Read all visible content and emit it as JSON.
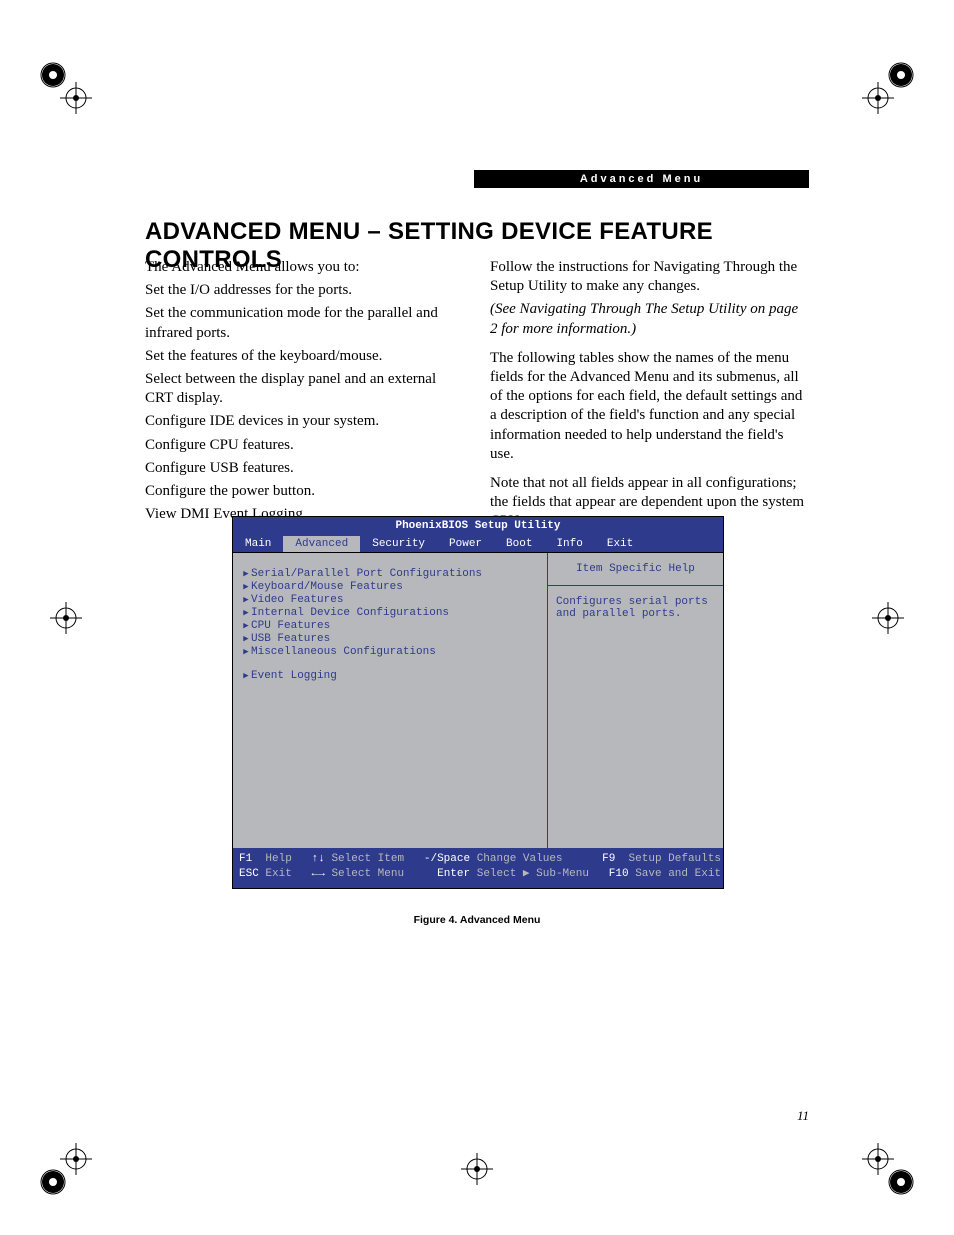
{
  "running_header": "Advanced Menu",
  "title": "ADVANCED MENU – SETTING DEVICE FEATURE CONTROLS",
  "intro": "The Advanced Menu allows you to:",
  "bullets": [
    "Set the I/O addresses for the ports.",
    "Set the communication mode for the parallel and infrared ports.",
    "Set the features of the keyboard/mouse.",
    "Select between the display panel and an external CRT display.",
    "Configure IDE devices in your system.",
    "Configure CPU features.",
    "Configure USB features.",
    "Configure the power button.",
    "View DMI Event Logging"
  ],
  "rcol": {
    "p1": "Follow the instructions for Navigating Through the Setup Utility to make any changes.",
    "p1i": "(See Navigating Through The Setup Utility on page 2 for more information.)",
    "p2": "The following tables show the names of the menu fields for the Advanced Menu and its submenus, all of the options for each field, the default settings and a description of the field's function and any special information needed to help understand the field's use.",
    "p3": "Note that not all fields appear in all configurations; the fields that appear are dependent upon the system CPU."
  },
  "bios": {
    "title": "PhoenixBIOS Setup Utility",
    "tabs": [
      "Main",
      "Advanced",
      "Security",
      "Power",
      "Boot",
      "Info",
      "Exit"
    ],
    "active_tab": 1,
    "menu": [
      "Serial/Parallel Port Configurations",
      "Keyboard/Mouse Features",
      "Video Features",
      "Internal Device Configurations",
      "CPU Features",
      "USB Features",
      "Miscellaneous Configurations",
      "",
      "Event Logging"
    ],
    "help_header": "Item Specific Help",
    "help_text": "Configures serial ports and parallel ports.",
    "footer": {
      "l1": {
        "a": "F1",
        "at": "Help",
        "b": "↑↓",
        "bt": "Select Item",
        "c": "-/Space",
        "ct": "Change Values",
        "d": "F9",
        "dt": "Setup Defaults"
      },
      "l2": {
        "a": "ESC",
        "at": "Exit",
        "b": "←→",
        "bt": "Select Menu",
        "c": "Enter",
        "ct": "Select ▶ Sub-Menu",
        "d": "F10",
        "dt": "Save and Exit"
      }
    }
  },
  "caption": "Figure 4.  Advanced Menu",
  "page_number": "11"
}
